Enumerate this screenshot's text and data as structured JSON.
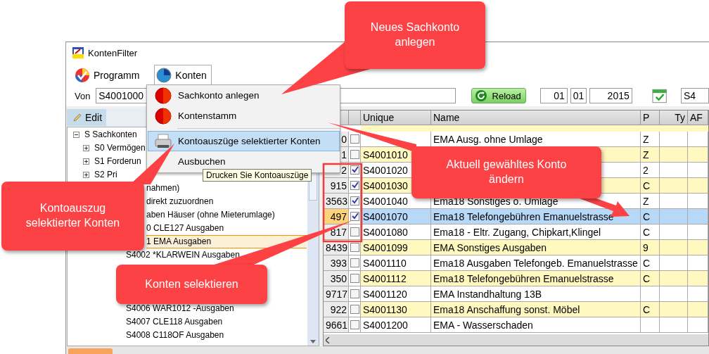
{
  "window": {
    "title": "KontenFilter"
  },
  "menubar": [
    {
      "label": "Programm",
      "open": false
    },
    {
      "label": "Konten",
      "open": true
    }
  ],
  "menu": {
    "groups": [
      {
        "items": [
          {
            "label": "Sachkonto anlegen",
            "highlighted": false
          },
          {
            "label": "Kontenstamm",
            "highlighted": false
          }
        ]
      },
      {
        "items": [
          {
            "label": "Kontoauszüge selektierter Konten",
            "highlighted": true
          },
          {
            "label": "Ausbuchen",
            "highlighted": false
          }
        ]
      }
    ]
  },
  "tooltip": "Drucken Sie Kontoauszüge",
  "filter": {
    "from_label": "Von",
    "from_value": "S4001000",
    "reload": "Reload",
    "day": "01",
    "month": "01",
    "year": "2015",
    "to_value": "S4"
  },
  "edit_button": "Edit",
  "tree": [
    {
      "label": "S Sachkonten",
      "expanded": true,
      "selected": false,
      "children": [
        {
          "label": "S0 Vermögen",
          "expanded": false,
          "selected": false
        },
        {
          "label": "S1 Forderun",
          "expanded": false,
          "selected": false
        },
        {
          "label": "S2 Pri",
          "expanded": false,
          "selected": false
        },
        {
          "label": "nahmen)",
          "clipped": true,
          "selected": false
        },
        {
          "label": "direkt zuzuordnen",
          "clipped": true,
          "selected": false
        },
        {
          "label": "aben Häuser (ohne Mieterumlage)",
          "clipped": true,
          "selected": false,
          "children": [
            {
              "label": "0 CLE127 Ausgaben",
              "clipped": true,
              "selected": false
            },
            {
              "label": "1 EMA Ausgaben",
              "clipped": true,
              "selected": true
            },
            {
              "label": "S4002 *KLARWEIN Ausgaben",
              "selected": false
            },
            {
              "label": "S4006 WAR1012 -Ausgaben",
              "selected": false
            },
            {
              "label": "S4007 CLE118 Ausgaben",
              "selected": false
            },
            {
              "label": "S4008 C118OF Ausgaben",
              "selected": false
            }
          ]
        }
      ]
    }
  ],
  "table": {
    "columns": [
      "Unique",
      "Name",
      "P",
      "Ty",
      "AF"
    ],
    "rows": [
      {
        "number": "0",
        "checked": false,
        "name": "EMA Ausg. ohne Umlage",
        "p": "Z",
        "selected": false
      },
      {
        "number": "1",
        "checked": false,
        "unique": "S4001010",
        "p": "Z",
        "selected": false
      },
      {
        "number": "2",
        "checked": true,
        "unique": "S4001020",
        "p": "2",
        "selected": false
      },
      {
        "number": "915",
        "checked": true,
        "unique": "S4001030",
        "p": "C",
        "selected": false
      },
      {
        "number": "3563",
        "checked": true,
        "unique": "S4001040",
        "name": "Ema18 Sonstiges o. Umlage",
        "p": "Z",
        "selected": false
      },
      {
        "number": "497",
        "checked": true,
        "unique": "S4001070",
        "name": "Ema18 Telefongebühren Emanuelstrasse",
        "p": "C",
        "selected": true
      },
      {
        "number": "817",
        "checked": false,
        "unique": "S4001080",
        "name": "Ema18  - Eltr. Zugang, Chipkart,Klingel",
        "p": "C",
        "selected": false
      },
      {
        "number": "8439",
        "checked": false,
        "unique": "S4001099",
        "name": "EMA Sonstiges Ausgaben",
        "p": "9",
        "selected": false
      },
      {
        "number": "393",
        "checked": false,
        "unique": "S4001110",
        "name": "Ema18 Ausgaben Telefongeb. Emanuelstrasse",
        "p": "C",
        "selected": false
      },
      {
        "number": "350",
        "checked": false,
        "unique": "S4001112",
        "name": "Ema18 Telefongebühren Emanuelstrasse",
        "p": "C",
        "selected": false
      },
      {
        "number": "9717",
        "checked": false,
        "unique": "S4001120",
        "name": "EMA Instandhaltung 13B",
        "selected": false
      },
      {
        "number": "922",
        "checked": false,
        "unique": "S4001130",
        "name": "Ema18 Anschaffung sonst. Möbel",
        "p": "C",
        "selected": false
      },
      {
        "number": "9661",
        "checked": false,
        "unique": "S4001200",
        "name": "EMA - Wasserschaden",
        "selected": false
      }
    ]
  },
  "callouts": [
    {
      "text": "Neues Sachkonto\nanlegen"
    },
    {
      "text": "Aktuell gewähltes Konto\nändern"
    },
    {
      "text": "Kontoauszug\nselektierter Konten"
    },
    {
      "text": "Konten selektieren"
    }
  ]
}
